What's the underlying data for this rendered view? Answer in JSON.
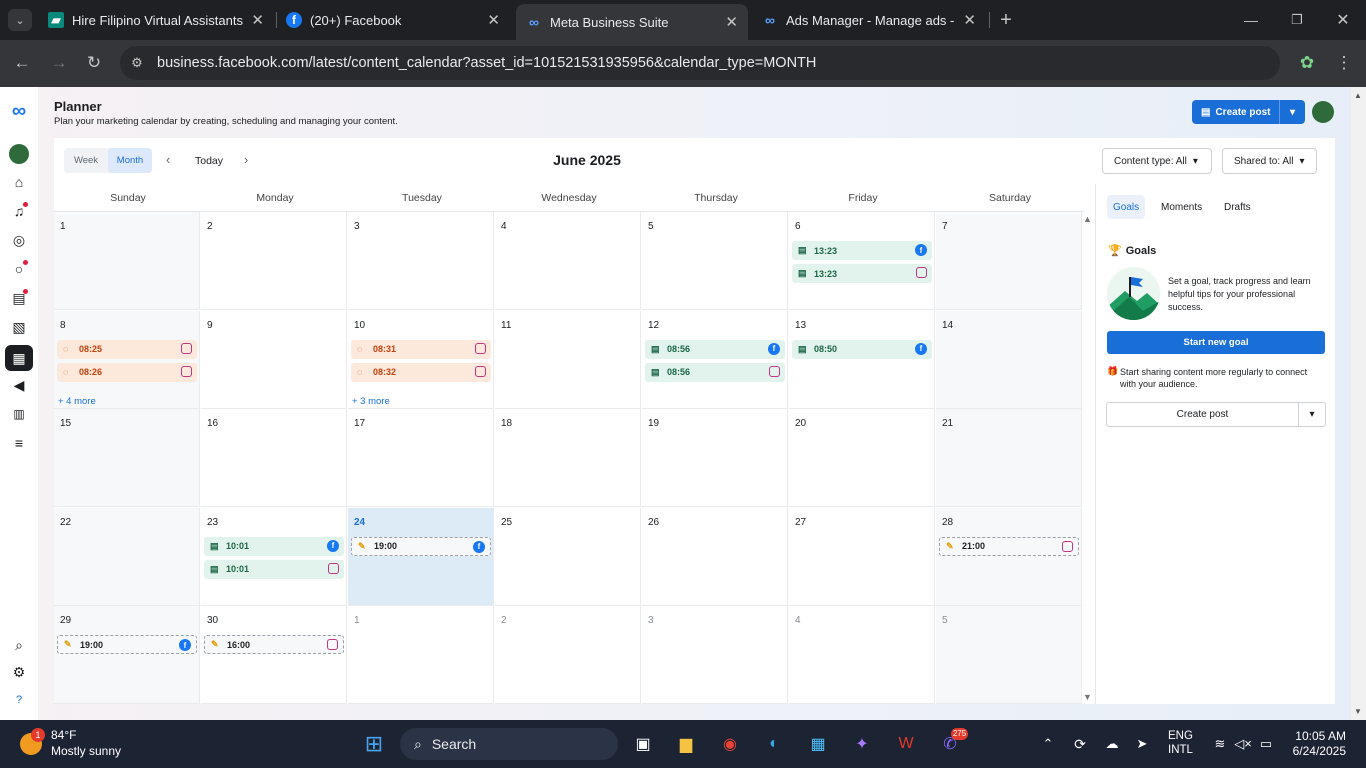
{
  "browser": {
    "tabs": [
      {
        "title": "Hire Filipino Virtual Assistants |",
        "icon": "va-favicon"
      },
      {
        "title": "(20+) Facebook",
        "icon": "facebook-icon"
      },
      {
        "title": "Meta Business Suite",
        "icon": "meta-icon",
        "active": true
      },
      {
        "title": "Ads Manager - Manage ads - A",
        "icon": "meta-icon"
      }
    ],
    "url": "business.facebook.com/latest/content_calendar?asset_id=101521531935956&calendar_type=MONTH"
  },
  "header": {
    "title": "Planner",
    "subtitle": "Plan your marketing calendar by creating, scheduling and managing your content.",
    "create_post": "Create post"
  },
  "toolbar": {
    "week": "Week",
    "month": "Month",
    "today": "Today",
    "month_label": "June 2025",
    "content_type": "Content type: All",
    "shared_to": "Shared to: All"
  },
  "weekdays": [
    "Sunday",
    "Monday",
    "Tuesday",
    "Wednesday",
    "Thursday",
    "Friday",
    "Saturday"
  ],
  "weeks": [
    [
      {
        "day": "1"
      },
      {
        "day": "2"
      },
      {
        "day": "3"
      },
      {
        "day": "4"
      },
      {
        "day": "5"
      },
      {
        "day": "6",
        "events": [
          {
            "time": "13:23",
            "status": "published",
            "net": "fb"
          },
          {
            "time": "13:23",
            "status": "published",
            "net": "ig"
          }
        ]
      },
      {
        "day": "7",
        "weekend": true
      }
    ],
    [
      {
        "day": "8",
        "events": [
          {
            "time": "08:25",
            "status": "pending",
            "net": "ig"
          },
          {
            "time": "08:26",
            "status": "pending",
            "net": "ig"
          }
        ],
        "more": "+ 4 more"
      },
      {
        "day": "9"
      },
      {
        "day": "10",
        "events": [
          {
            "time": "08:31",
            "status": "pending",
            "net": "ig"
          },
          {
            "time": "08:32",
            "status": "pending",
            "net": "ig"
          }
        ],
        "more": "+ 3 more"
      },
      {
        "day": "11"
      },
      {
        "day": "12",
        "events": [
          {
            "time": "08:56",
            "status": "published",
            "net": "fb"
          },
          {
            "time": "08:56",
            "status": "published",
            "net": "ig"
          }
        ]
      },
      {
        "day": "13",
        "events": [
          {
            "time": "08:50",
            "status": "published",
            "net": "fb"
          }
        ]
      },
      {
        "day": "14",
        "weekend": true
      }
    ],
    [
      {
        "day": "15"
      },
      {
        "day": "16"
      },
      {
        "day": "17"
      },
      {
        "day": "18"
      },
      {
        "day": "19"
      },
      {
        "day": "20"
      },
      {
        "day": "21",
        "weekend": true
      }
    ],
    [
      {
        "day": "22"
      },
      {
        "day": "23",
        "events": [
          {
            "time": "10:01",
            "status": "published",
            "net": "fb"
          },
          {
            "time": "10:01",
            "status": "published",
            "net": "ig"
          }
        ]
      },
      {
        "day": "24",
        "today": true,
        "events": [
          {
            "time": "19:00",
            "status": "draft",
            "net": "fb"
          }
        ]
      },
      {
        "day": "25"
      },
      {
        "day": "26"
      },
      {
        "day": "27"
      },
      {
        "day": "28",
        "weekend": true,
        "events": [
          {
            "time": "21:00",
            "status": "draft",
            "net": "ig"
          }
        ]
      }
    ],
    [
      {
        "day": "29",
        "events": [
          {
            "time": "19:00",
            "status": "draft",
            "net": "fb"
          }
        ]
      },
      {
        "day": "30",
        "events": [
          {
            "time": "16:00",
            "status": "draft",
            "net": "ig"
          }
        ]
      },
      {
        "day": "1",
        "other": true
      },
      {
        "day": "2",
        "other": true
      },
      {
        "day": "3",
        "other": true
      },
      {
        "day": "4",
        "other": true
      },
      {
        "day": "5",
        "other": true,
        "weekend": true
      }
    ]
  ],
  "side": {
    "tabs": [
      "Goals",
      "Moments",
      "Drafts"
    ],
    "goals_heading": "Goals",
    "goals_text": "Set a goal, track progress and learn helpful tips for your professional success.",
    "start_goal": "Start new goal",
    "share_text": "Start sharing content more regularly to connect with your audience.",
    "create_post": "Create post"
  },
  "taskbar": {
    "temp": "84°F",
    "weather": "Mostly sunny",
    "search": "Search",
    "lang1": "ENG",
    "lang2": "INTL",
    "time": "10:05 AM",
    "date": "6/24/2025",
    "badge": "275",
    "weather_badge": "1"
  }
}
